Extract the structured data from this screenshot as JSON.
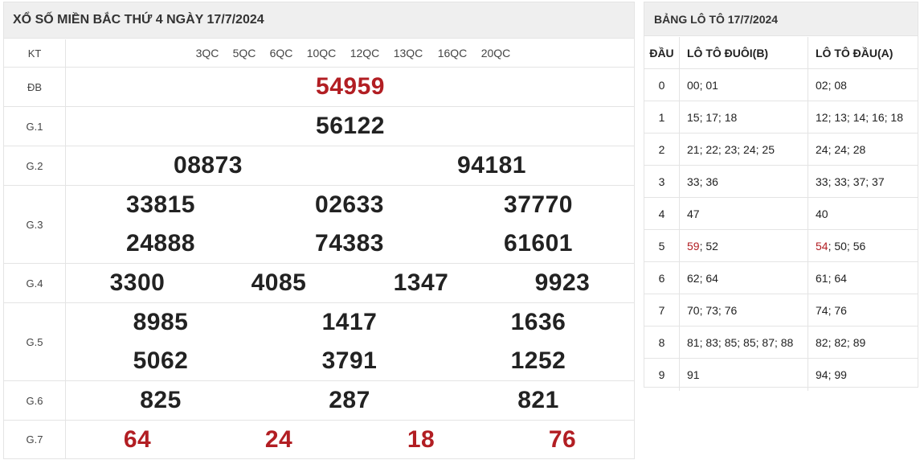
{
  "results": {
    "title": "XỔ SỐ MIỀN BẮC THỨ 4 NGÀY 17/7/2024",
    "kt_label": "KT",
    "qc_codes": [
      "3QC",
      "5QC",
      "6QC",
      "10QC",
      "12QC",
      "13QC",
      "16QC",
      "20QC"
    ],
    "prizes": {
      "db": {
        "label": "ĐB",
        "numbers": [
          "54959"
        ]
      },
      "g1": {
        "label": "G.1",
        "numbers": [
          "56122"
        ]
      },
      "g2": {
        "label": "G.2",
        "numbers": [
          "08873",
          "94181"
        ]
      },
      "g3": {
        "label": "G.3",
        "numbers": [
          "33815",
          "02633",
          "37770",
          "24888",
          "74383",
          "61601"
        ]
      },
      "g4": {
        "label": "G.4",
        "numbers": [
          "3300",
          "4085",
          "1347",
          "9923"
        ]
      },
      "g5": {
        "label": "G.5",
        "numbers": [
          "8985",
          "1417",
          "1636",
          "5062",
          "3791",
          "1252"
        ]
      },
      "g6": {
        "label": "G.6",
        "numbers": [
          "825",
          "287",
          "821"
        ]
      },
      "g7": {
        "label": "G.7",
        "numbers": [
          "64",
          "24",
          "18",
          "76"
        ]
      }
    },
    "highlight_color": "#b21e23"
  },
  "loto": {
    "title": "BẢNG LÔ TÔ 17/7/2024",
    "headers": {
      "dau": "ĐẦU",
      "duoi": "LÔ TÔ ĐUÔI(B)",
      "dau_a": "LÔ TÔ ĐẦU(A)"
    },
    "rows": [
      {
        "head": "0",
        "duoi_hl": "",
        "duoi": "00; 01",
        "dau_hl": "",
        "dau": "02; 08"
      },
      {
        "head": "1",
        "duoi_hl": "",
        "duoi": "15; 17; 18",
        "dau_hl": "",
        "dau": "12; 13; 14; 16; 18"
      },
      {
        "head": "2",
        "duoi_hl": "",
        "duoi": "21; 22; 23; 24; 25",
        "dau_hl": "",
        "dau": "24; 24; 28"
      },
      {
        "head": "3",
        "duoi_hl": "",
        "duoi": "33; 36",
        "dau_hl": "",
        "dau": "33; 33; 37; 37"
      },
      {
        "head": "4",
        "duoi_hl": "",
        "duoi": "47",
        "dau_hl": "",
        "dau": "40"
      },
      {
        "head": "5",
        "duoi_hl": "59",
        "duoi": "; 52",
        "dau_hl": "54",
        "dau": "; 50; 56"
      },
      {
        "head": "6",
        "duoi_hl": "",
        "duoi": "62; 64",
        "dau_hl": "",
        "dau": "61; 64"
      },
      {
        "head": "7",
        "duoi_hl": "",
        "duoi": "70; 73; 76",
        "dau_hl": "",
        "dau": "74; 76"
      },
      {
        "head": "8",
        "duoi_hl": "",
        "duoi": "81; 83; 85; 85; 87; 88",
        "dau_hl": "",
        "dau": "82; 82; 89"
      },
      {
        "head": "9",
        "duoi_hl": "",
        "duoi": "91",
        "dau_hl": "",
        "dau": "94; 99"
      }
    ]
  }
}
